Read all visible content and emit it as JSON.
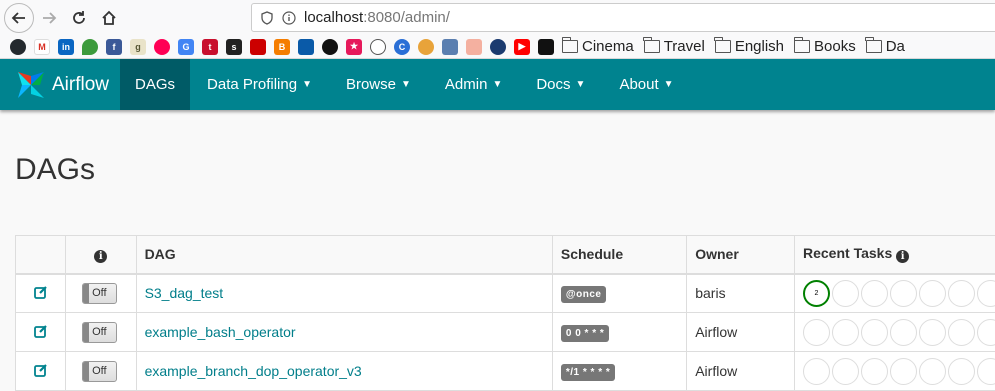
{
  "browser": {
    "url_host": "localhost",
    "url_path": ":8080/admin/",
    "bookmark_folders": [
      "Cinema",
      "Travel",
      "English",
      "Books",
      "Da"
    ]
  },
  "navbar": {
    "brand": "Airflow",
    "items": [
      {
        "label": "DAGs",
        "active": true,
        "dropdown": false
      },
      {
        "label": "Data Profiling",
        "dropdown": true
      },
      {
        "label": "Browse",
        "dropdown": true
      },
      {
        "label": "Admin",
        "dropdown": true
      },
      {
        "label": "Docs",
        "dropdown": true
      },
      {
        "label": "About",
        "dropdown": true
      }
    ],
    "color": "#00838f"
  },
  "page": {
    "title": "DAGs"
  },
  "table": {
    "headers": {
      "info": "i",
      "dag": "DAG",
      "schedule": "Schedule",
      "owner": "Owner",
      "recent_tasks": "Recent Tasks"
    },
    "rows": [
      {
        "toggle": "Off",
        "dag": "S3_dag_test",
        "schedule": "@once",
        "owner": "baris",
        "success_count": "2"
      },
      {
        "toggle": "Off",
        "dag": "example_bash_operator",
        "schedule": "0 0 * * *",
        "owner": "Airflow",
        "success_count": ""
      },
      {
        "toggle": "Off",
        "dag": "example_branch_dop_operator_v3",
        "schedule": "*/1 * * * *",
        "owner": "Airflow",
        "success_count": ""
      }
    ]
  }
}
